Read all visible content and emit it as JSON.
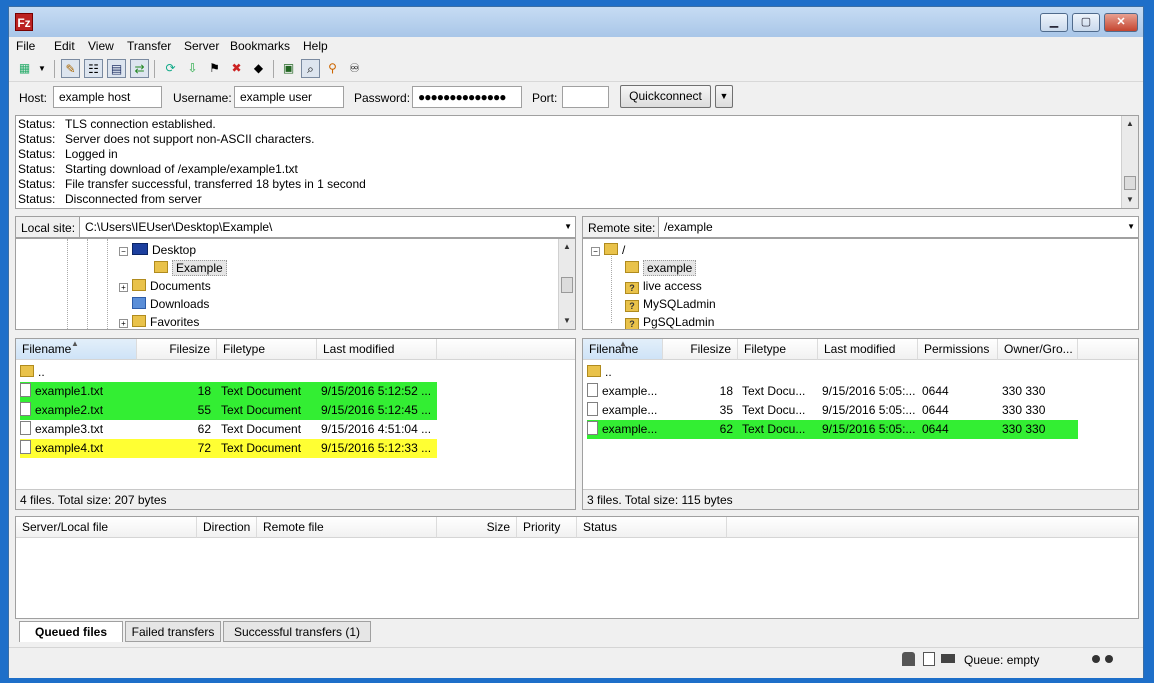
{
  "window": {
    "app_icon": "Fz",
    "buttons": {
      "minimize": "▁",
      "maximize": "▢",
      "close": "✕"
    }
  },
  "menu": [
    "File",
    "Edit",
    "View",
    "Transfer",
    "Server",
    "Bookmarks",
    "Help"
  ],
  "toolbar": {
    "icons": [
      "site-manager-icon",
      "dropdown-arrow-icon",
      "toggle-log-icon",
      "toggle-local-tree-icon",
      "toggle-remote-tree-icon",
      "toggle-queue-icon",
      "refresh-icon",
      "process-queue-icon",
      "cancel-icon",
      "disconnect-icon",
      "reconnect-icon",
      "compare-icon",
      "sync-browse-icon",
      "filter-icon",
      "search-icon"
    ]
  },
  "quickconnect": {
    "host_label": "Host:",
    "host_value": "example host",
    "username_label": "Username:",
    "username_value": "example user",
    "password_label": "Password:",
    "password_value": "●●●●●●●●●●●●●●",
    "port_label": "Port:",
    "port_value": "",
    "button_label": "Quickconnect",
    "dropdown_glyph": "▼"
  },
  "log": [
    {
      "key": "Status:",
      "text": "TLS connection established."
    },
    {
      "key": "Status:",
      "text": "Server does not support non-ASCII characters."
    },
    {
      "key": "Status:",
      "text": "Logged in"
    },
    {
      "key": "Status:",
      "text": "Starting download of /example/example1.txt"
    },
    {
      "key": "Status:",
      "text": "File transfer successful, transferred 18 bytes in 1 second"
    },
    {
      "key": "Status:",
      "text": "Disconnected from server"
    }
  ],
  "local": {
    "site_label": "Local site:",
    "path": "C:\\Users\\IEUser\\Desktop\\Example\\",
    "tree": [
      "Desktop",
      "Example",
      "Documents",
      "Downloads",
      "Favorites"
    ],
    "headers": [
      "Filename",
      "Filesize",
      "Filetype",
      "Last modified"
    ],
    "files": [
      {
        "name": "..",
        "size": "",
        "type": "",
        "modified": ""
      },
      {
        "name": "example1.txt",
        "size": "18",
        "type": "Text Document",
        "modified": "9/15/2016 5:12:52 ..."
      },
      {
        "name": "example2.txt",
        "size": "55",
        "type": "Text Document",
        "modified": "9/15/2016 5:12:45 ..."
      },
      {
        "name": "example3.txt",
        "size": "62",
        "type": "Text Document",
        "modified": "9/15/2016 4:51:04 ..."
      },
      {
        "name": "example4.txt",
        "size": "72",
        "type": "Text Document",
        "modified": "9/15/2016 5:12:33 ..."
      }
    ],
    "summary": "4 files. Total size: 207 bytes"
  },
  "remote": {
    "site_label": "Remote site:",
    "path": "/example",
    "tree": [
      "/",
      "example",
      "live access",
      "MySQLadmin",
      "PgSQLadmin"
    ],
    "headers": [
      "Filename",
      "Filesize",
      "Filetype",
      "Last modified",
      "Permissions",
      "Owner/Gro..."
    ],
    "files": [
      {
        "name": "..",
        "size": "",
        "type": "",
        "modified": "",
        "perms": "",
        "owner": ""
      },
      {
        "name": "example...",
        "size": "18",
        "type": "Text Docu...",
        "modified": "9/15/2016 5:05:...",
        "perms": "0644",
        "owner": "330 330"
      },
      {
        "name": "example...",
        "size": "35",
        "type": "Text Docu...",
        "modified": "9/15/2016 5:05:...",
        "perms": "0644",
        "owner": "330 330"
      },
      {
        "name": "example...",
        "size": "62",
        "type": "Text Docu...",
        "modified": "9/15/2016 5:05:...",
        "perms": "0644",
        "owner": "330 330"
      }
    ],
    "summary": "3 files. Total size: 115 bytes"
  },
  "queue": {
    "headers": [
      "Server/Local file",
      "Direction",
      "Remote file",
      "Size",
      "Priority",
      "Status"
    ],
    "tabs": [
      "Queued files",
      "Failed transfers",
      "Successful transfers (1)"
    ]
  },
  "statusbar": {
    "queue_text": "Queue: empty"
  },
  "colors": {
    "highlight_green": "#33ee33",
    "highlight_yellow": "#ffff33",
    "desktop_bg": "#1e6fc9"
  }
}
